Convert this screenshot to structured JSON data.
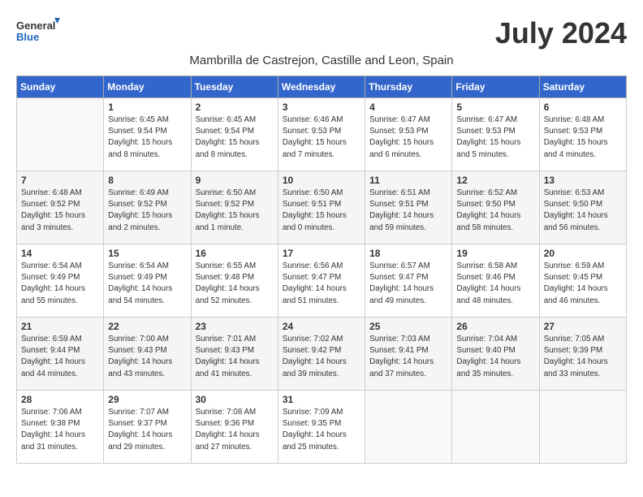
{
  "logo": {
    "general": "General",
    "blue": "Blue"
  },
  "title": "July 2024",
  "subtitle": "Mambrilla de Castrejon, Castille and Leon, Spain",
  "weekdays": [
    "Sunday",
    "Monday",
    "Tuesday",
    "Wednesday",
    "Thursday",
    "Friday",
    "Saturday"
  ],
  "weeks": [
    [
      {
        "day": "",
        "content": ""
      },
      {
        "day": "1",
        "content": "Sunrise: 6:45 AM\nSunset: 9:54 PM\nDaylight: 15 hours\nand 8 minutes."
      },
      {
        "day": "2",
        "content": "Sunrise: 6:45 AM\nSunset: 9:54 PM\nDaylight: 15 hours\nand 8 minutes."
      },
      {
        "day": "3",
        "content": "Sunrise: 6:46 AM\nSunset: 9:53 PM\nDaylight: 15 hours\nand 7 minutes."
      },
      {
        "day": "4",
        "content": "Sunrise: 6:47 AM\nSunset: 9:53 PM\nDaylight: 15 hours\nand 6 minutes."
      },
      {
        "day": "5",
        "content": "Sunrise: 6:47 AM\nSunset: 9:53 PM\nDaylight: 15 hours\nand 5 minutes."
      },
      {
        "day": "6",
        "content": "Sunrise: 6:48 AM\nSunset: 9:53 PM\nDaylight: 15 hours\nand 4 minutes."
      }
    ],
    [
      {
        "day": "7",
        "content": "Sunrise: 6:48 AM\nSunset: 9:52 PM\nDaylight: 15 hours\nand 3 minutes."
      },
      {
        "day": "8",
        "content": "Sunrise: 6:49 AM\nSunset: 9:52 PM\nDaylight: 15 hours\nand 2 minutes."
      },
      {
        "day": "9",
        "content": "Sunrise: 6:50 AM\nSunset: 9:52 PM\nDaylight: 15 hours\nand 1 minute."
      },
      {
        "day": "10",
        "content": "Sunrise: 6:50 AM\nSunset: 9:51 PM\nDaylight: 15 hours\nand 0 minutes."
      },
      {
        "day": "11",
        "content": "Sunrise: 6:51 AM\nSunset: 9:51 PM\nDaylight: 14 hours\nand 59 minutes."
      },
      {
        "day": "12",
        "content": "Sunrise: 6:52 AM\nSunset: 9:50 PM\nDaylight: 14 hours\nand 58 minutes."
      },
      {
        "day": "13",
        "content": "Sunrise: 6:53 AM\nSunset: 9:50 PM\nDaylight: 14 hours\nand 56 minutes."
      }
    ],
    [
      {
        "day": "14",
        "content": "Sunrise: 6:54 AM\nSunset: 9:49 PM\nDaylight: 14 hours\nand 55 minutes."
      },
      {
        "day": "15",
        "content": "Sunrise: 6:54 AM\nSunset: 9:49 PM\nDaylight: 14 hours\nand 54 minutes."
      },
      {
        "day": "16",
        "content": "Sunrise: 6:55 AM\nSunset: 9:48 PM\nDaylight: 14 hours\nand 52 minutes."
      },
      {
        "day": "17",
        "content": "Sunrise: 6:56 AM\nSunset: 9:47 PM\nDaylight: 14 hours\nand 51 minutes."
      },
      {
        "day": "18",
        "content": "Sunrise: 6:57 AM\nSunset: 9:47 PM\nDaylight: 14 hours\nand 49 minutes."
      },
      {
        "day": "19",
        "content": "Sunrise: 6:58 AM\nSunset: 9:46 PM\nDaylight: 14 hours\nand 48 minutes."
      },
      {
        "day": "20",
        "content": "Sunrise: 6:59 AM\nSunset: 9:45 PM\nDaylight: 14 hours\nand 46 minutes."
      }
    ],
    [
      {
        "day": "21",
        "content": "Sunrise: 6:59 AM\nSunset: 9:44 PM\nDaylight: 14 hours\nand 44 minutes."
      },
      {
        "day": "22",
        "content": "Sunrise: 7:00 AM\nSunset: 9:43 PM\nDaylight: 14 hours\nand 43 minutes."
      },
      {
        "day": "23",
        "content": "Sunrise: 7:01 AM\nSunset: 9:43 PM\nDaylight: 14 hours\nand 41 minutes."
      },
      {
        "day": "24",
        "content": "Sunrise: 7:02 AM\nSunset: 9:42 PM\nDaylight: 14 hours\nand 39 minutes."
      },
      {
        "day": "25",
        "content": "Sunrise: 7:03 AM\nSunset: 9:41 PM\nDaylight: 14 hours\nand 37 minutes."
      },
      {
        "day": "26",
        "content": "Sunrise: 7:04 AM\nSunset: 9:40 PM\nDaylight: 14 hours\nand 35 minutes."
      },
      {
        "day": "27",
        "content": "Sunrise: 7:05 AM\nSunset: 9:39 PM\nDaylight: 14 hours\nand 33 minutes."
      }
    ],
    [
      {
        "day": "28",
        "content": "Sunrise: 7:06 AM\nSunset: 9:38 PM\nDaylight: 14 hours\nand 31 minutes."
      },
      {
        "day": "29",
        "content": "Sunrise: 7:07 AM\nSunset: 9:37 PM\nDaylight: 14 hours\nand 29 minutes."
      },
      {
        "day": "30",
        "content": "Sunrise: 7:08 AM\nSunset: 9:36 PM\nDaylight: 14 hours\nand 27 minutes."
      },
      {
        "day": "31",
        "content": "Sunrise: 7:09 AM\nSunset: 9:35 PM\nDaylight: 14 hours\nand 25 minutes."
      },
      {
        "day": "",
        "content": ""
      },
      {
        "day": "",
        "content": ""
      },
      {
        "day": "",
        "content": ""
      }
    ]
  ]
}
